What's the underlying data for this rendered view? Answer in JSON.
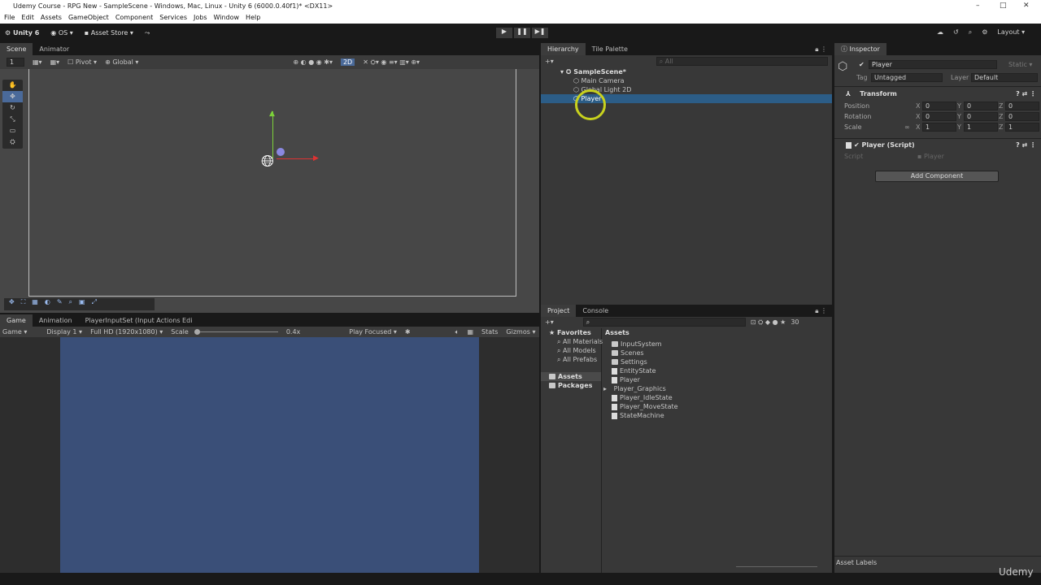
{
  "window": {
    "title": "Udemy Course - RPG New - SampleScene - Windows, Mac, Linux - Unity 6 (6000.0.40f1)* <DX11>",
    "minimize": "–",
    "maximize": "□",
    "close": "✕"
  },
  "menu": [
    "File",
    "Edit",
    "Assets",
    "GameObject",
    "Component",
    "Services",
    "Jobs",
    "Window",
    "Help"
  ],
  "toolbar": {
    "account": "Unity 6",
    "os": "OS",
    "asset_store": "Asset Store",
    "layout": "Layout"
  },
  "scene": {
    "tabs": [
      "Scene",
      "Animator"
    ],
    "layer": "1",
    "pivot": "Pivot",
    "global": "Global",
    "mode_2d": "2D"
  },
  "game": {
    "tabs": [
      "Game",
      "Animation",
      "PlayerInputSet (Input Actions Edi"
    ],
    "game": "Game",
    "display": "Display 1",
    "resolution": "Full HD (1920x1080)",
    "scale_label": "Scale",
    "scale_value": "0.4x",
    "play_focused": "Play Focused",
    "stats": "Stats",
    "gizmos": "Gizmos",
    "bg_color": "#3a4f78"
  },
  "hierarchy": {
    "tabs": [
      "Hierarchy",
      "Tile Palette"
    ],
    "search_placeholder": "All",
    "scene": "SampleScene*",
    "items": [
      "Main Camera",
      "Global Light 2D",
      "Player"
    ],
    "selected": "Player"
  },
  "project": {
    "tabs": [
      "Project",
      "Console"
    ],
    "count": "30",
    "favorites": "Favorites",
    "fav_items": [
      "All Materials",
      "All Models",
      "All Prefabs"
    ],
    "roots": [
      "Assets",
      "Packages"
    ],
    "breadcrumb": "Assets",
    "items": [
      {
        "name": "InputSystem",
        "type": "folder"
      },
      {
        "name": "Scenes",
        "type": "folder"
      },
      {
        "name": "Settings",
        "type": "folder"
      },
      {
        "name": "EntityState",
        "type": "script"
      },
      {
        "name": "Player",
        "type": "script"
      },
      {
        "name": "Player_Graphics",
        "type": "prefab"
      },
      {
        "name": "Player_IdleState",
        "type": "script"
      },
      {
        "name": "Player_MoveState",
        "type": "script"
      },
      {
        "name": "StateMachine",
        "type": "script"
      }
    ]
  },
  "inspector": {
    "tab": "Inspector",
    "name": "Player",
    "static": "Static",
    "tag_label": "Tag",
    "tag": "Untagged",
    "layer_label": "Layer",
    "layer": "Default",
    "transform": {
      "title": "Transform",
      "rows": [
        {
          "label": "Position",
          "x": "0",
          "y": "0",
          "z": "0"
        },
        {
          "label": "Rotation",
          "x": "0",
          "y": "0",
          "z": "0"
        },
        {
          "label": "Scale",
          "x": "1",
          "y": "1",
          "z": "1"
        }
      ]
    },
    "script": {
      "title": "Player (Script)",
      "label": "Script",
      "value": "Player"
    },
    "add_component": "Add Component",
    "asset_labels": "Asset Labels"
  },
  "watermark": "Udemy"
}
